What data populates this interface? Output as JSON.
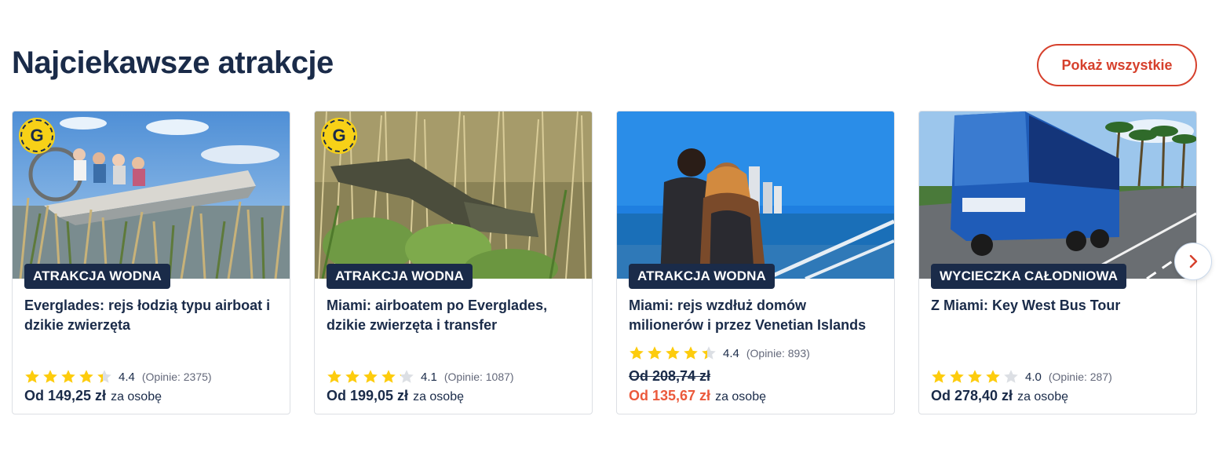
{
  "section": {
    "title": "Najciekawsze atrakcje",
    "show_all_label": "Pokaż wszystkie"
  },
  "cards": [
    {
      "category": "ATRAKCJA WODNA",
      "title": "Everglades: rejs łodzią typu airboat i dzikie zwierzęta",
      "rating_value": "4.4",
      "rating_stars": 4.4,
      "reviews": "(Opinie: 2375)",
      "price": "Od 149,25 zł",
      "per_person": "za osobę",
      "badge": "G",
      "image": "airboat-tourists"
    },
    {
      "category": "ATRAKCJA WODNA",
      "title": "Miami: airboatem po Everglades, dzikie zwierzęta i transfer",
      "rating_value": "4.1",
      "rating_stars": 4.1,
      "reviews": "(Opinie: 1087)",
      "price": "Od 199,05 zł",
      "per_person": "za osobę",
      "badge": "G",
      "image": "alligator-grass"
    },
    {
      "category": "ATRAKCJA WODNA",
      "title": "Miami: rejs wzdłuż domów milionerów i przez Venetian Islands",
      "rating_value": "4.4",
      "rating_stars": 4.4,
      "reviews": "(Opinie: 893)",
      "old_price": "Od 208,74 zł",
      "price": "Od 135,67 zł",
      "per_person": "za osobę",
      "image": "couple-boat-skyline"
    },
    {
      "category": "WYCIECZKA CAŁODNIOWA",
      "title": "Z Miami: Key West Bus Tour",
      "rating_value": "4.0",
      "rating_stars": 4.0,
      "reviews": "(Opinie: 287)",
      "price": "Od 278,40 zł",
      "per_person": "za osobę",
      "image": "blue-tour-bus"
    }
  ],
  "icons": {
    "next": "chevron-right-icon",
    "star": "star-icon"
  },
  "colors": {
    "primary_text": "#1a2b49",
    "accent_red": "#d6402c",
    "sale_price": "#eb5a3c",
    "star_gold": "#fdcc0d",
    "tag_bg": "#1a2b49"
  }
}
